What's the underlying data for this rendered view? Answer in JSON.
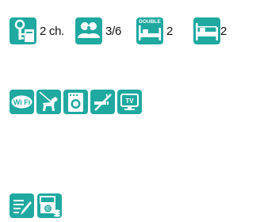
{
  "capacity": {
    "bedrooms": {
      "label": "2 ch.",
      "icon": "key-bedroom-icon"
    },
    "guests": {
      "label": "3/6",
      "icon": "people-icon"
    },
    "double_beds": {
      "label": "2",
      "badge": "DOUBLE",
      "icon": "double-bed-icon"
    },
    "single_beds": {
      "label": "2",
      "icon": "single-bed-icon"
    }
  },
  "amenities": [
    {
      "name": "wifi-icon",
      "text": "Wi Fi"
    },
    {
      "name": "pets-allowed-icon"
    },
    {
      "name": "washing-machine-icon"
    },
    {
      "name": "no-smoking-icon"
    },
    {
      "name": "tv-icon",
      "text": "TV"
    }
  ],
  "services": [
    {
      "name": "registration-form-icon"
    },
    {
      "name": "payment-cheque-money-icon",
      "text": "©"
    }
  ],
  "colors": {
    "icon_bg": "#1fa9a0",
    "text": "#111111"
  }
}
